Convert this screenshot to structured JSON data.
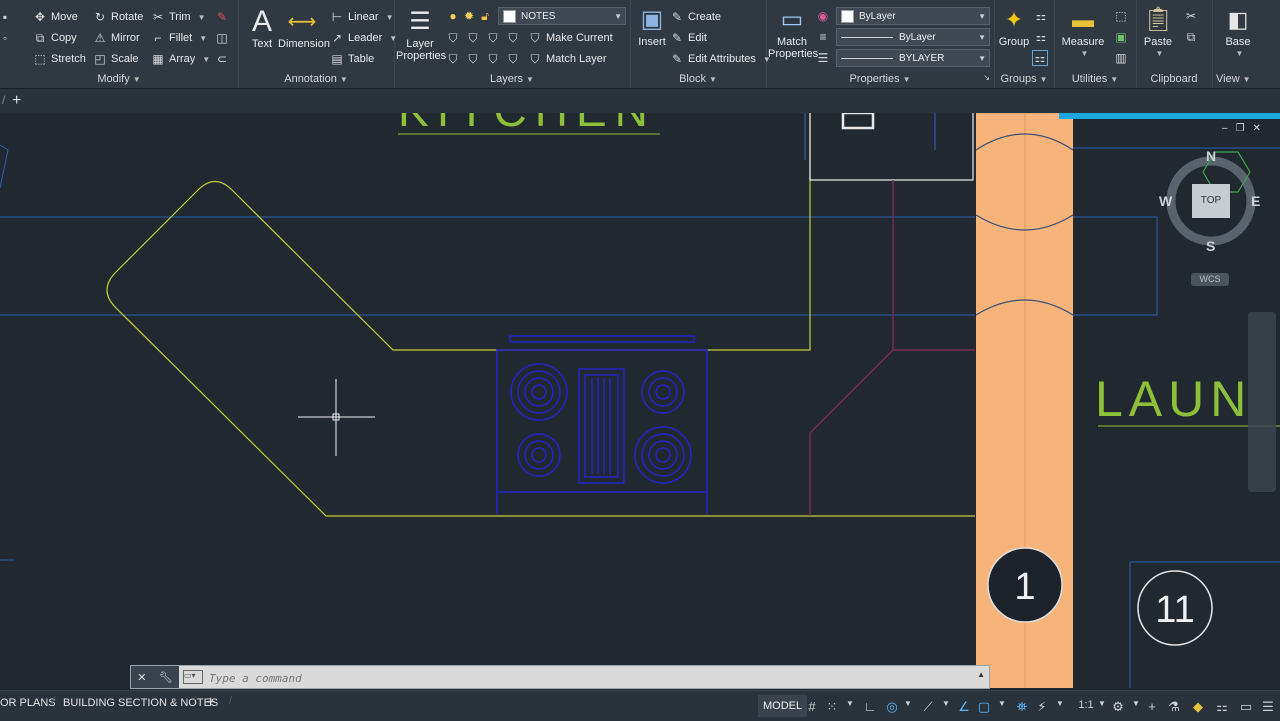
{
  "ribbon": {
    "modify": {
      "title": "Modify",
      "move": "Move",
      "rotate": "Rotate",
      "trim": "Trim",
      "copy": "Copy",
      "mirror": "Mirror",
      "fillet": "Fillet",
      "stretch": "Stretch",
      "scale": "Scale",
      "array": "Array"
    },
    "annotation": {
      "title": "Annotation",
      "text": "Text",
      "dimension": "Dimension",
      "linear": "Linear",
      "leader": "Leader",
      "table": "Table"
    },
    "layers": {
      "title": "Layers",
      "layer_properties": "Layer Properties",
      "current_layer": "NOTES",
      "make_current": "Make Current",
      "match_layer": "Match Layer"
    },
    "block": {
      "title": "Block",
      "insert": "Insert",
      "create": "Create",
      "edit": "Edit",
      "edit_attributes": "Edit Attributes"
    },
    "properties": {
      "title": "Properties",
      "match_properties": "Match Properties",
      "color": "ByLayer",
      "linetype": "ByLayer",
      "lineweight": "BYLAYER"
    },
    "groups": {
      "title": "Groups",
      "group": "Group"
    },
    "utilities": {
      "title": "Utilities",
      "measure": "Measure"
    },
    "clipboard": {
      "title": "Clipboard",
      "paste": "Paste"
    },
    "view": {
      "title": "View",
      "base": "Base"
    }
  },
  "drawing": {
    "labels": {
      "kitchen": "KITCHEN",
      "laundry": "LAUN"
    },
    "markers": {
      "one": "1",
      "eleven": "11"
    },
    "colors": {
      "counter": "#c8cf3a",
      "wall_blue": "#2a5fb0",
      "stove": "#2323c8",
      "corridor": "#f7b47a",
      "label": "#8dbf3a",
      "magenta": "#8a2a5e"
    }
  },
  "viewcube": {
    "n": "N",
    "s": "S",
    "e": "E",
    "w": "W",
    "top": "TOP",
    "wcs": "WCS"
  },
  "commandline": {
    "placeholder": "Type a command"
  },
  "statusbar": {
    "layout_tabs": [
      "OR PLANS",
      "BUILDING SECTION & NOTES"
    ],
    "model": "MODEL",
    "scale": "1:1"
  }
}
